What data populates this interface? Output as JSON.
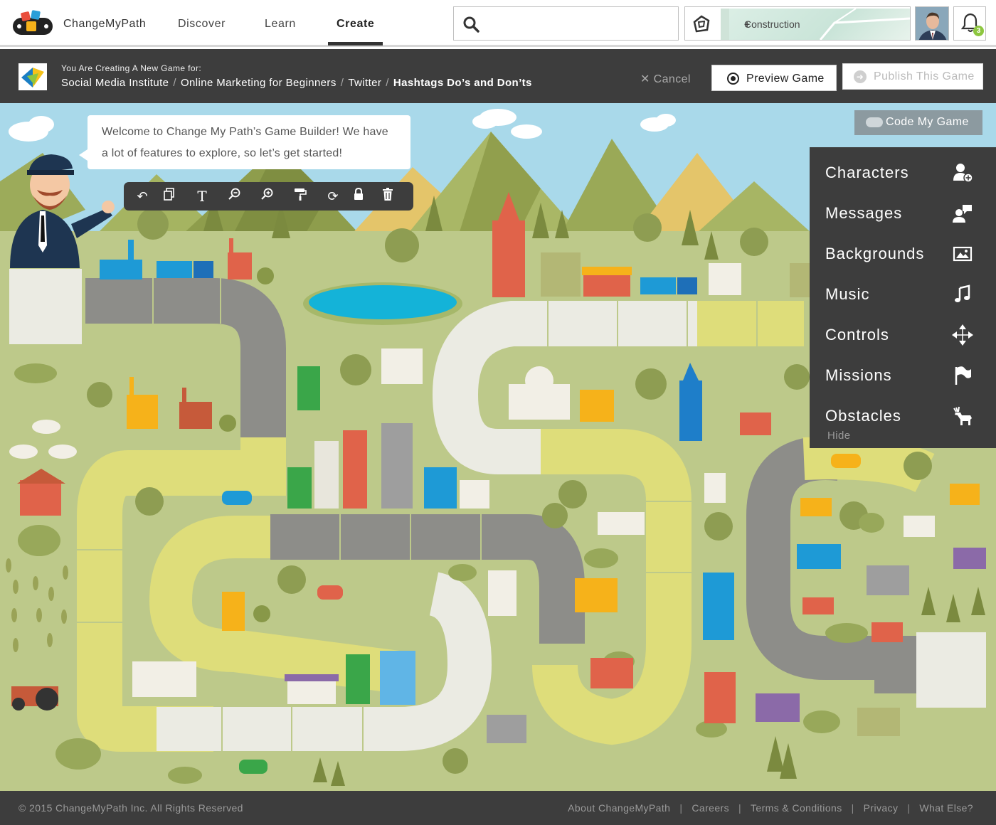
{
  "nav": {
    "brand": "ChangeMyPath",
    "links": [
      {
        "label": "Discover"
      },
      {
        "label": "Learn"
      },
      {
        "label": "Create",
        "active": true
      }
    ],
    "search": {
      "value": "",
      "placeholder": ""
    },
    "current_game": {
      "title": "Construction"
    },
    "notifications": {
      "count": "3"
    }
  },
  "create_bar": {
    "creating_label": "You Are Creating A New Game for:",
    "breadcrumb": [
      "Social Media Institute",
      "Online Marketing for Beginners",
      "Twitter",
      "Hashtags Do’s and Don’ts"
    ],
    "cancel_label": "Cancel",
    "preview_label": "Preview Game",
    "publish_label": "Publish This Game"
  },
  "editor": {
    "welcome_message": "Welcome to Change My Path’s Game Builder! We have a lot of features to explore, so let’s get started!",
    "toolbar_tools": [
      "undo-icon",
      "copy-icon",
      "text-icon",
      "zoom-out-icon",
      "zoom-in-icon",
      "paint-roller-icon",
      "refresh-icon",
      "lock-icon",
      "trash-icon"
    ],
    "code_button_label": "Code My Game",
    "side_menu": {
      "items": [
        {
          "label": "Characters",
          "icon": "add-user-icon"
        },
        {
          "label": "Messages",
          "icon": "user-message-icon"
        },
        {
          "label": "Backgrounds",
          "icon": "image-icon"
        },
        {
          "label": "Music",
          "icon": "music-note-icon"
        },
        {
          "label": "Controls",
          "icon": "move-arrows-icon"
        },
        {
          "label": "Missions",
          "icon": "flag-icon"
        },
        {
          "label": "Obstacles",
          "icon": "moose-icon"
        }
      ],
      "hide_label": "Hide"
    }
  },
  "footer": {
    "copyright": "© 2015 ChangeMyPath Inc. All Rights Reserved",
    "links": [
      "About ChangeMyPath",
      "Careers",
      "Terms & Conditions",
      "Privacy",
      "What Else?"
    ]
  },
  "colors": {
    "dark_panel": "#3d3d3d",
    "map_grass": "#bdc98a",
    "sky": "#a9d9ea",
    "road": "#8d8d89",
    "path_light": "#ebebe3",
    "path_yellow": "#dedd7a",
    "lake": "#14b3d8"
  }
}
